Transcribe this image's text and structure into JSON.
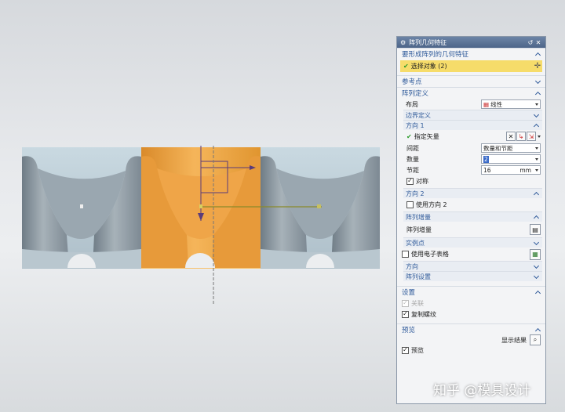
{
  "dialog": {
    "title": "阵列几何特征",
    "icons": [
      "gear-icon",
      "reset-icon",
      "close-icon"
    ]
  },
  "sections": {
    "geometry": {
      "label": "要形成阵列的几何特征",
      "select_objects": "选择对象 (2)"
    },
    "reference": {
      "label": "参考点"
    },
    "pattern_def": {
      "label": "阵列定义",
      "layout_label": "布局",
      "layout_value": "线性",
      "boundary": "边界定义",
      "dir1": {
        "label": "方向 1",
        "vector_label": "指定矢量",
        "spacing_label": "间距",
        "spacing_value": "数量和节距",
        "count_label": "数量",
        "count_value": "2",
        "pitch_label": "节距",
        "pitch_value": "16",
        "pitch_unit": "mm",
        "symmetric_label": "对称",
        "symmetric_checked": true
      },
      "dir2": {
        "label": "方向 2",
        "use_label": "使用方向 2",
        "use_checked": false
      },
      "increment": {
        "label": "阵列增量",
        "row_label": "阵列增量"
      },
      "instance": {
        "label": "实例点",
        "spreadsheet_label": "使用电子表格",
        "spreadsheet_checked": false
      },
      "orientation": {
        "label": "方向"
      },
      "pattern_settings": {
        "label": "阵列设置"
      }
    },
    "settings": {
      "label": "设置",
      "associative_label": "关联",
      "associative_checked": true,
      "copy_threads_label": "复制螺纹",
      "copy_threads_checked": true
    },
    "preview": {
      "label": "预览",
      "show_result_label": "显示结果",
      "preview_label": "预览",
      "preview_checked": true
    }
  },
  "watermark": "知乎 @模具设计",
  "colors": {
    "accent": "#2f5a9a",
    "highlight": "#f6dc6a",
    "selected_body": "#f0a848",
    "body": "#8e9aa3"
  }
}
